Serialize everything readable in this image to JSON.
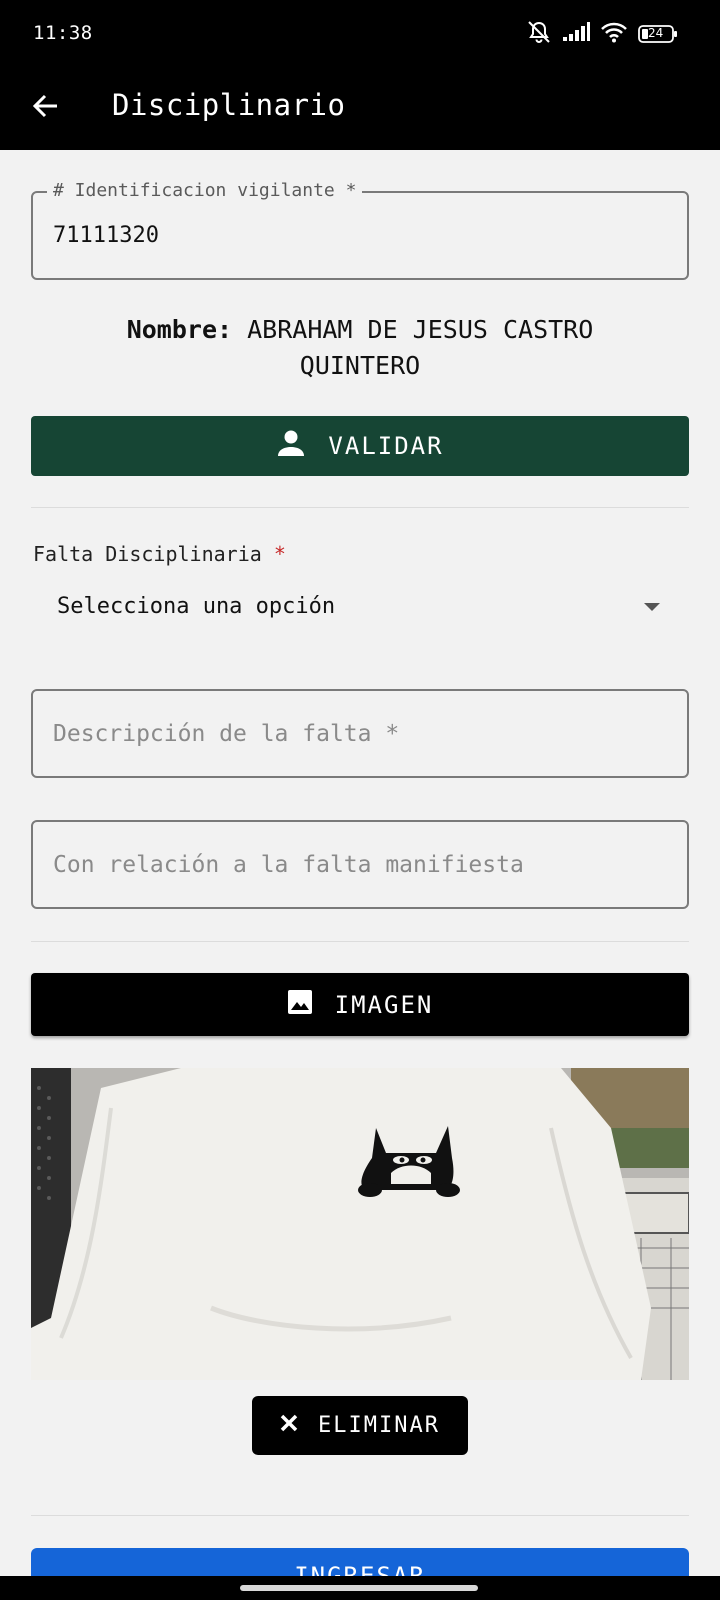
{
  "status_bar": {
    "time": "11:38",
    "battery": "24",
    "icons": [
      "bell-off-icon",
      "signal-icon",
      "wifi-icon",
      "battery-icon"
    ]
  },
  "app_bar": {
    "title": "Disciplinario",
    "back_icon": "arrow-left-icon"
  },
  "form": {
    "id_field": {
      "label": "# Identificacion vigilante *",
      "value": "71111320"
    },
    "nombre": {
      "label": "Nombre:",
      "value": "ABRAHAM DE JESUS CASTRO QUINTERO"
    },
    "validar_button": {
      "label": "VALIDAR",
      "icon": "person-icon"
    },
    "falta_select": {
      "label": "Falta Disciplinaria",
      "required_mark": "*",
      "selected": "Selecciona una opción"
    },
    "descripcion_field": {
      "placeholder": "Descripción de la falta *"
    },
    "relacion_field": {
      "placeholder": "Con relación a la falta manifiesta"
    },
    "imagen_button": {
      "label": "IMAGEN",
      "icon": "image-icon"
    },
    "photo": {
      "alt": ""
    },
    "eliminar_button": {
      "label": "ELIMINAR",
      "icon": "close-icon"
    },
    "ingresar_button": {
      "label": "INGRESAR"
    }
  },
  "colors": {
    "validar": "#164534",
    "imagen": "#000000",
    "ingresar": "#1565d8",
    "required": "#c62828"
  }
}
